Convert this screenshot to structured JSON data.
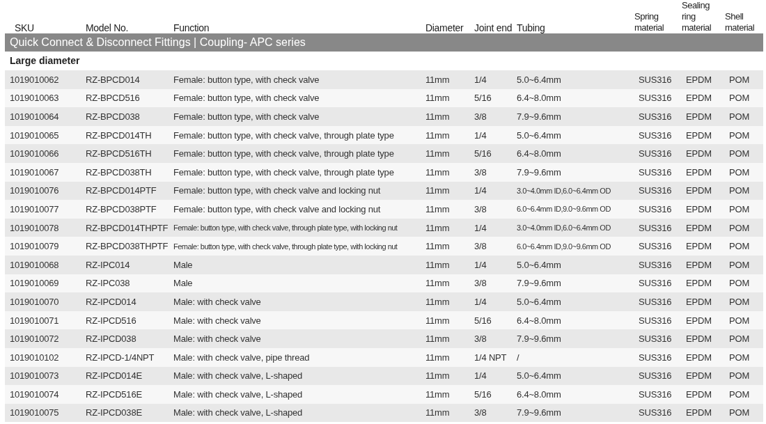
{
  "table": {
    "columns": [
      "SKU",
      "Model No.",
      "Function",
      "Diameter",
      "Joint end",
      "Tubing",
      "Spring material",
      "Sealing ring material",
      "Shell material"
    ],
    "section_title": "Quick Connect & Disconnect Fittings | Coupling- APC series",
    "group_title": "Large diameter",
    "rows": [
      [
        "1019010062",
        "RZ-BPCD014",
        "Female: button type, with check valve",
        "11mm",
        "1/4",
        "5.0~6.4mm",
        "SUS316",
        "EPDM",
        "POM"
      ],
      [
        "1019010063",
        "RZ-BPCD516",
        "Female: button type, with check valve",
        "11mm",
        "5/16",
        "6.4~8.0mm",
        "SUS316",
        "EPDM",
        "POM"
      ],
      [
        "1019010064",
        "RZ-BPCD038",
        "Female: button type, with check valve",
        "11mm",
        "3/8",
        "7.9~9.6mm",
        "SUS316",
        "EPDM",
        "POM"
      ],
      [
        "1019010065",
        "RZ-BPCD014TH",
        "Female: button type, with check valve, through plate type",
        "11mm",
        "1/4",
        "5.0~6.4mm",
        "SUS316",
        "EPDM",
        "POM"
      ],
      [
        "1019010066",
        "RZ-BPCD516TH",
        "Female: button type, with check valve, through plate type",
        "11mm",
        "5/16",
        "6.4~8.0mm",
        "SUS316",
        "EPDM",
        "POM"
      ],
      [
        "1019010067",
        "RZ-BPCD038TH",
        "Female: button type, with check valve, through plate type",
        "11mm",
        "3/8",
        "7.9~9.6mm",
        "SUS316",
        "EPDM",
        "POM"
      ],
      [
        "1019010076",
        "RZ-BPCD014PTF",
        "Female: button type, with check valve and locking nut",
        "11mm",
        "1/4",
        "3.0~4.0mm ID,6.0~6.4mm OD",
        "SUS316",
        "EPDM",
        "POM"
      ],
      [
        "1019010077",
        "RZ-BPCD038PTF",
        "Female: button type, with check valve and locking nut",
        "11mm",
        "3/8",
        "6.0~6.4mm ID,9.0~9.6mm OD",
        "SUS316",
        "EPDM",
        "POM"
      ],
      [
        "1019010078",
        "RZ-BPCD014THPTF",
        "Female: button type, with check valve, through plate type, with locking nut",
        "11mm",
        "1/4",
        "3.0~4.0mm ID,6.0~6.4mm OD",
        "SUS316",
        "EPDM",
        "POM"
      ],
      [
        "1019010079",
        "RZ-BPCD038THPTF",
        "Female: button type, with check valve, through plate type, with locking nut",
        "11mm",
        "3/8",
        "6.0~6.4mm ID,9.0~9.6mm OD",
        "SUS316",
        "EPDM",
        "POM"
      ],
      [
        "1019010068",
        "RZ-IPC014",
        "Male",
        "11mm",
        "1/4",
        "5.0~6.4mm",
        "SUS316",
        "EPDM",
        "POM"
      ],
      [
        "1019010069",
        "RZ-IPC038",
        "Male",
        "11mm",
        "3/8",
        "7.9~9.6mm",
        "SUS316",
        "EPDM",
        "POM"
      ],
      [
        "1019010070",
        "RZ-IPCD014",
        "Male: with check valve",
        "11mm",
        "1/4",
        "5.0~6.4mm",
        "SUS316",
        "EPDM",
        "POM"
      ],
      [
        "1019010071",
        "RZ-IPCD516",
        "Male: with check valve",
        "11mm",
        "5/16",
        "6.4~8.0mm",
        "SUS316",
        "EPDM",
        "POM"
      ],
      [
        "1019010072",
        "RZ-IPCD038",
        "Male: with check valve",
        "11mm",
        "3/8",
        "7.9~9.6mm",
        "SUS316",
        "EPDM",
        "POM"
      ],
      [
        "1019010102",
        "RZ-IPCD-1/4NPT",
        "Male: with check valve, pipe thread",
        "11mm",
        "1/4 NPT",
        "/",
        "SUS316",
        "EPDM",
        "POM"
      ],
      [
        "1019010073",
        "RZ-IPCD014E",
        "Male: with check valve, L-shaped",
        "11mm",
        "1/4",
        "5.0~6.4mm",
        "SUS316",
        "EPDM",
        "POM"
      ],
      [
        "1019010074",
        "RZ-IPCD516E",
        "Male: with check valve, L-shaped",
        "11mm",
        "5/16",
        "6.4~8.0mm",
        "SUS316",
        "EPDM",
        "POM"
      ],
      [
        "1019010075",
        "RZ-IPCD038E",
        "Male: with check valve, L-shaped",
        "11mm",
        "3/8",
        "7.9~9.6mm",
        "SUS316",
        "EPDM",
        "POM"
      ]
    ]
  }
}
